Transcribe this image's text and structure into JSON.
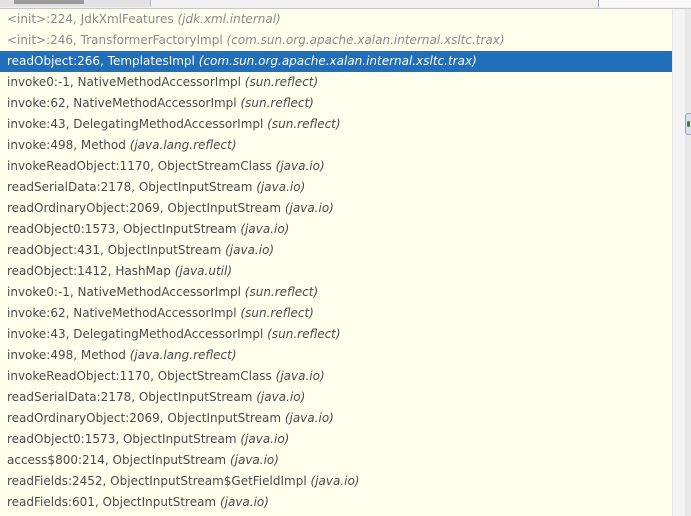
{
  "frames": [
    {
      "method": "<init>:224, JdkXmlFeatures",
      "pkg": "(jdk.xml.internal)",
      "state": "faded"
    },
    {
      "method": "<init>:246, TransformerFactoryImpl",
      "pkg": "(com.sun.org.apache.xalan.internal.xsltc.trax)",
      "state": "faded"
    },
    {
      "method": "readObject:266, TemplatesImpl",
      "pkg": "(com.sun.org.apache.xalan.internal.xsltc.trax)",
      "state": "selected"
    },
    {
      "method": "invoke0:-1, NativeMethodAccessorImpl",
      "pkg": "(sun.reflect)",
      "state": ""
    },
    {
      "method": "invoke:62, NativeMethodAccessorImpl",
      "pkg": "(sun.reflect)",
      "state": ""
    },
    {
      "method": "invoke:43, DelegatingMethodAccessorImpl",
      "pkg": "(sun.reflect)",
      "state": ""
    },
    {
      "method": "invoke:498, Method",
      "pkg": "(java.lang.reflect)",
      "state": ""
    },
    {
      "method": "invokeReadObject:1170, ObjectStreamClass",
      "pkg": "(java.io)",
      "state": ""
    },
    {
      "method": "readSerialData:2178, ObjectInputStream",
      "pkg": "(java.io)",
      "state": ""
    },
    {
      "method": "readOrdinaryObject:2069, ObjectInputStream",
      "pkg": "(java.io)",
      "state": ""
    },
    {
      "method": "readObject0:1573, ObjectInputStream",
      "pkg": "(java.io)",
      "state": ""
    },
    {
      "method": "readObject:431, ObjectInputStream",
      "pkg": "(java.io)",
      "state": ""
    },
    {
      "method": "readObject:1412, HashMap",
      "pkg": "(java.util)",
      "state": ""
    },
    {
      "method": "invoke0:-1, NativeMethodAccessorImpl",
      "pkg": "(sun.reflect)",
      "state": ""
    },
    {
      "method": "invoke:62, NativeMethodAccessorImpl",
      "pkg": "(sun.reflect)",
      "state": ""
    },
    {
      "method": "invoke:43, DelegatingMethodAccessorImpl",
      "pkg": "(sun.reflect)",
      "state": ""
    },
    {
      "method": "invoke:498, Method",
      "pkg": "(java.lang.reflect)",
      "state": ""
    },
    {
      "method": "invokeReadObject:1170, ObjectStreamClass",
      "pkg": "(java.io)",
      "state": ""
    },
    {
      "method": "readSerialData:2178, ObjectInputStream",
      "pkg": "(java.io)",
      "state": ""
    },
    {
      "method": "readOrdinaryObject:2069, ObjectInputStream",
      "pkg": "(java.io)",
      "state": ""
    },
    {
      "method": "readObject0:1573, ObjectInputStream",
      "pkg": "(java.io)",
      "state": ""
    },
    {
      "method": "access$800:214, ObjectInputStream",
      "pkg": "(java.io)",
      "state": ""
    },
    {
      "method": "readFields:2452, ObjectInputStream$GetFieldImpl",
      "pkg": "(java.io)",
      "state": ""
    },
    {
      "method": "readFields:601, ObjectInputStream",
      "pkg": "(java.io)",
      "state": ""
    }
  ],
  "colors": {
    "panel_background": "#ffffee",
    "selection": "#1f6fba",
    "text": "#4a4a4a"
  }
}
